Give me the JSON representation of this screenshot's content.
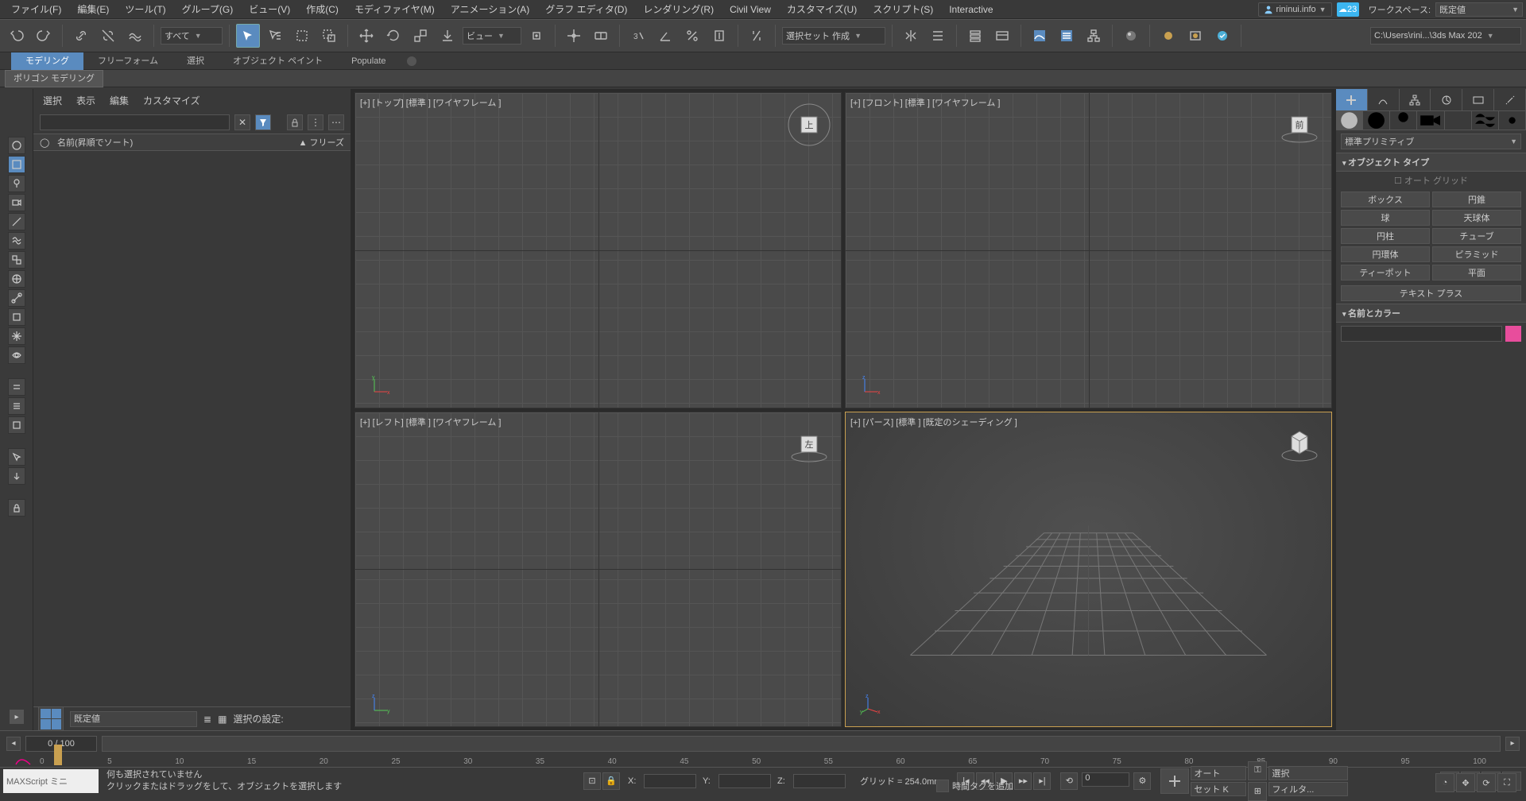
{
  "menu": {
    "items": [
      "ファイル(F)",
      "編集(E)",
      "ツール(T)",
      "グループ(G)",
      "ビュー(V)",
      "作成(C)",
      "モディファイヤ(M)",
      "アニメーション(A)",
      "グラフ エディタ(D)",
      "レンダリング(R)",
      "Civil View",
      "カスタマイズ(U)",
      "スクリプト(S)",
      "Interactive"
    ],
    "user": "rininui.info",
    "notif": "23",
    "workspace_label": "ワークスペース:",
    "workspace_value": "既定値"
  },
  "toolbar": {
    "scope": "すべて",
    "view": "ビュー",
    "selset": "選択セット 作成",
    "path": "C:\\Users\\rini...\\3ds Max 202"
  },
  "ribbon": {
    "tabs": [
      "モデリング",
      "フリーフォーム",
      "選択",
      "オブジェクト ペイント",
      "Populate"
    ],
    "sub": "ポリゴン モデリング"
  },
  "scene": {
    "menus": [
      "選択",
      "表示",
      "編集",
      "カスタマイズ"
    ],
    "col_icon": "",
    "col_name": "名前(昇順でソート)",
    "col_freeze": "▲ フリーズ",
    "preset": "既定値",
    "selset_label": "選択の設定:"
  },
  "viewports": {
    "top": "[+]  [トップ]  [標準 ]  [ワイヤフレーム ]",
    "front": "[+]  [フロント]  [標準 ]  [ワイヤフレーム ]",
    "left": "[+]  [レフト]  [標準 ]  [ワイヤフレーム ]",
    "persp": "[+]  [パース]  [標準 ]  [既定のシェーディング ]",
    "cube_top": "上",
    "cube_front": "前",
    "cube_left": "左"
  },
  "cmd": {
    "category": "標準プリミティブ",
    "rollout_objtype": "オブジェクト タイプ",
    "autogrid": "オート グリッド",
    "buttons": [
      "ボックス",
      "円錐",
      "球",
      "天球体",
      "円柱",
      "チューブ",
      "円環体",
      "ピラミッド",
      "ティーポット",
      "平面"
    ],
    "textplus": "テキスト プラス",
    "rollout_name": "名前とカラー"
  },
  "time": {
    "frame": "0 / 100",
    "ticks": [
      "0",
      "5",
      "10",
      "15",
      "20",
      "25",
      "30",
      "35",
      "40",
      "45",
      "50",
      "55",
      "60",
      "65",
      "70",
      "75",
      "80",
      "85",
      "90",
      "95",
      "100"
    ]
  },
  "status": {
    "maxscript": "MAXScript ミニ",
    "msg1": "何も選択されていません",
    "msg2": "クリックまたはドラッグをして、オブジェクトを選択します",
    "x": "X:",
    "y": "Y:",
    "z": "Z:",
    "grid": "グリッド = 254.0mm",
    "timetag": "時間タグを追加",
    "spin": "0",
    "auto": "オート",
    "setk": "セット K",
    "sel": "選択",
    "filter": "フィルタ..."
  }
}
